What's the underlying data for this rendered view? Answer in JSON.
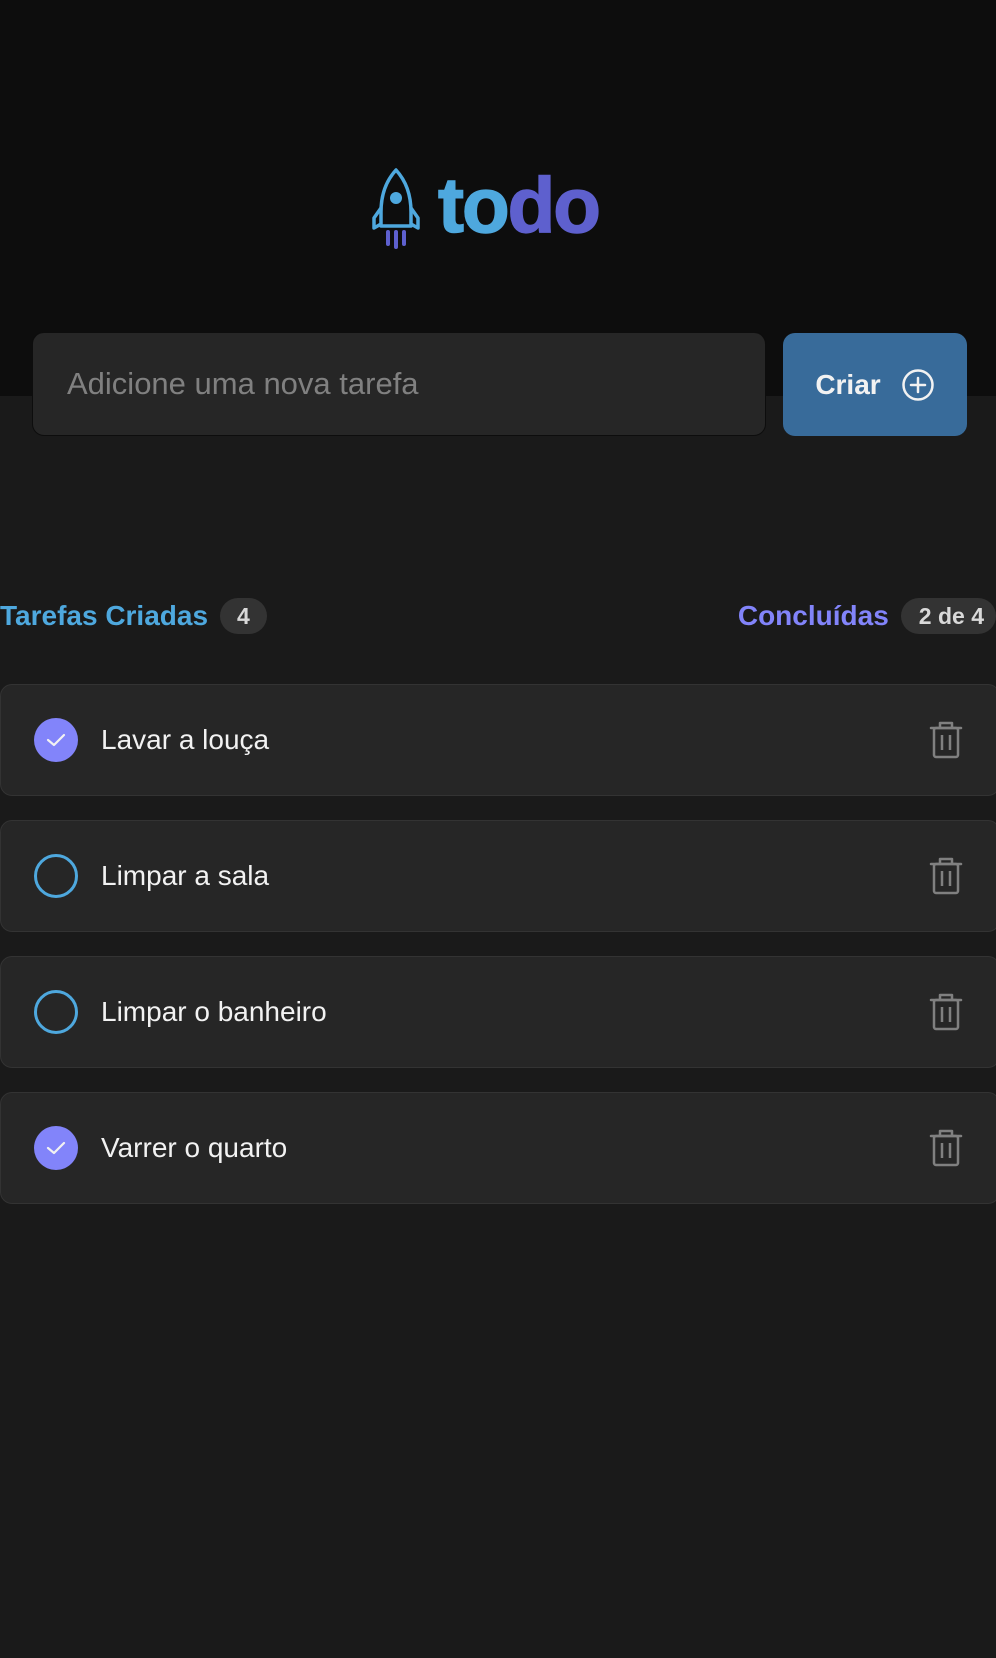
{
  "header": {
    "logo_part1": "to",
    "logo_part2": "do",
    "logo_icon": "rocket-icon",
    "logo_colors": {
      "to": "#4ea8de",
      "do": "#5e60ce"
    }
  },
  "new_task": {
    "placeholder": "Adicione uma nova tarefa",
    "value": "",
    "button_label": "Criar",
    "button_icon": "plus-circle-icon",
    "button_color": "#386b9a"
  },
  "summary": {
    "created_label": "Tarefas Criadas",
    "created_count": "4",
    "done_label": "Concluídas",
    "done_count": "2 de 4"
  },
  "tasks": [
    {
      "text": "Lavar a louça",
      "done": true
    },
    {
      "text": "Limpar a sala",
      "done": false
    },
    {
      "text": "Limpar o banheiro",
      "done": false
    },
    {
      "text": "Varrer o quarto",
      "done": true
    }
  ],
  "colors": {
    "background": "#1a1a1a",
    "header_background": "#0d0d0d",
    "card": "#262626",
    "blue": "#4ea8de",
    "purple": "#8284fa",
    "text": "#f2f2f2"
  }
}
